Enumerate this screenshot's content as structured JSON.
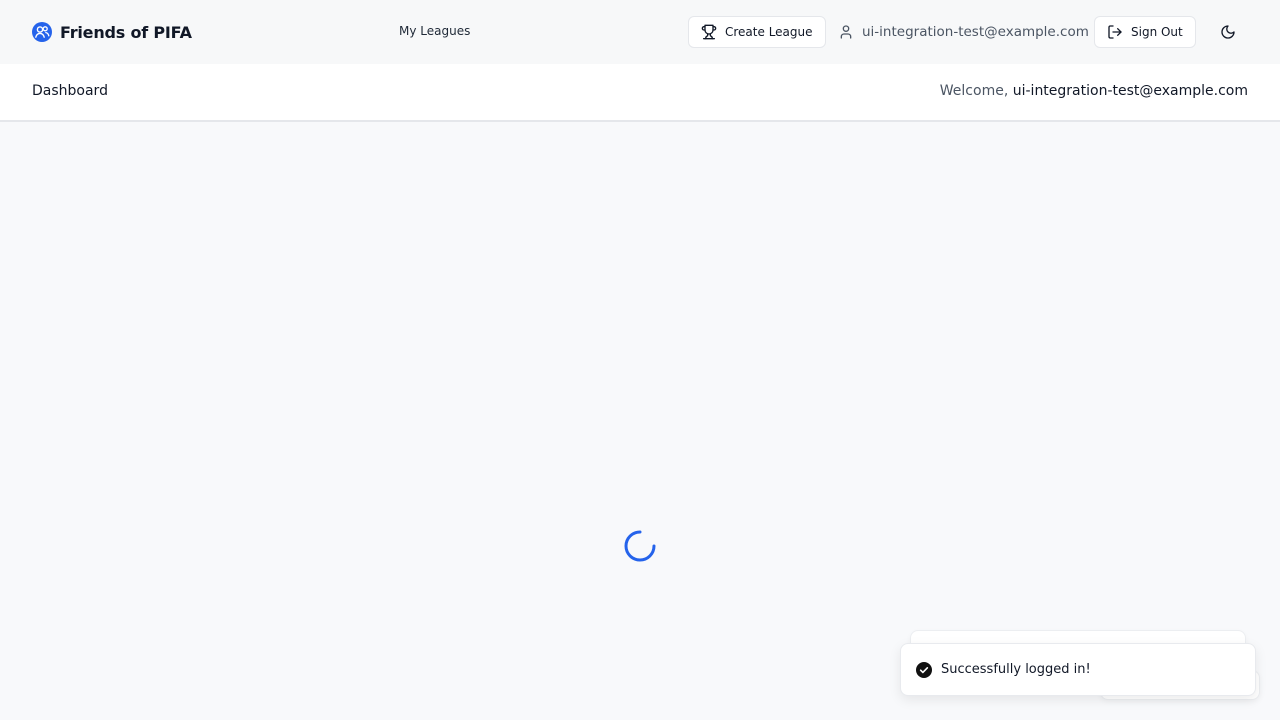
{
  "app": {
    "name": "Friends of PIFA",
    "brand_icon": "users-circle-icon",
    "accent_color": "#2563eb"
  },
  "nav": {
    "my_leagues": "My Leagues"
  },
  "header_actions": {
    "create_league_label": "Create League",
    "create_league_icon": "trophy-icon",
    "user_email": "ui-integration-test@example.com",
    "user_icon": "user-icon",
    "sign_out_label": "Sign Out",
    "sign_out_icon": "log-out-icon",
    "theme_toggle_icon": "moon-icon"
  },
  "subheader": {
    "title": "Dashboard",
    "welcome_prefix": "Welcome, ",
    "welcome_email": "ui-integration-test@example.com"
  },
  "loading": {
    "spinner_icon": "loading-spinner-icon"
  },
  "toast": {
    "message": "Successfully logged in!",
    "icon": "check-circle-icon"
  }
}
